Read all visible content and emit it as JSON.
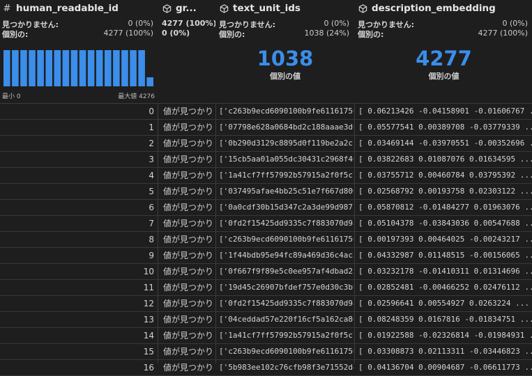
{
  "columns": {
    "human_readable_id": {
      "title": "human_readable_id",
      "icon": "hash-icon",
      "missing_label": "見つかりません:",
      "missing_value": "0 (0%)",
      "distinct_label": "個別の:",
      "distinct_value": "4277 (100%)",
      "min_label": "最小 0",
      "max_label": "最大値 4276",
      "histogram": [
        1,
        1,
        1,
        1,
        1,
        1,
        1,
        1,
        1,
        1,
        1,
        1,
        1,
        1,
        1,
        1,
        1,
        0.25
      ]
    },
    "graph": {
      "title": "gr...",
      "icon": "cube-icon",
      "line1_left": "4277 (100%)",
      "line1_right": "0 (0%)"
    },
    "text_unit_ids": {
      "title": "text_unit_ids",
      "icon": "cube-icon",
      "missing_label": "見つかりません:",
      "missing_value": "0 (0%)",
      "distinct_label": "個別の:",
      "distinct_value": "1038 (24%)",
      "big_number": "1038",
      "big_caption": "個別の値"
    },
    "description_embedding": {
      "title": "description_embedding",
      "icon": "cube-icon",
      "missing_label": "見つかりません:",
      "missing_value": "0 (0%)",
      "distinct_label": "個別の:",
      "distinct_value": "4277 (100%)",
      "big_number": "4277",
      "big_caption": "個別の値"
    }
  },
  "colors": {
    "accent": "#3b8eea",
    "background": "#1e1e1e"
  },
  "rows": [
    {
      "idx": "0",
      "graph": "値が見つかり",
      "text_unit": "['c263b9ecd6090100b9fe61161756d",
      "embedding": "[ 0.06213426 -0.04158901 -0.01606767 ... 0.00"
    },
    {
      "idx": "1",
      "graph": "値が見つかり",
      "text_unit": "['07798e628a0684bd2c188aaae3d6a",
      "embedding": "[ 0.05577541 0.00389708 -0.03779339 ... -0.001"
    },
    {
      "idx": "2",
      "graph": "値が見つかり",
      "text_unit": "['0b290d3129c8895d0f119be2a2cc0",
      "embedding": "[ 0.03469144 -0.03970551 -0.00352696 ... -0.02"
    },
    {
      "idx": "3",
      "graph": "値が見つかり",
      "text_unit": "['15cb5aa01a055dc30431c2968f4086",
      "embedding": "[ 0.03822683 0.01087076 0.01634595 ... -0.034"
    },
    {
      "idx": "4",
      "graph": "値が見つかり",
      "text_unit": "['1a41cf7ff57992b57915a2f0f5c727d",
      "embedding": "[ 0.03755712 0.00460784 0.03795392 ... -0.0115"
    },
    {
      "idx": "5",
      "graph": "値が見つかり",
      "text_unit": "['037495afae4bb25c51e7f667d8005f",
      "embedding": "[ 0.02568792 0.00193758 0.02303122 ... 0.0026"
    },
    {
      "idx": "6",
      "graph": "値が見つかり",
      "text_unit": "['0a0cdf30b15d347c2a3de99d987f72",
      "embedding": "[ 0.05870812 -0.01484277 0.01963076 ... 0.0005"
    },
    {
      "idx": "7",
      "graph": "値が見つかり",
      "text_unit": "['0fd2f15425dd9335c7f883070d9a8e",
      "embedding": "[ 0.05104378 -0.03843036 0.00547688 ... -0.012"
    },
    {
      "idx": "8",
      "graph": "値が見つかり",
      "text_unit": "['c263b9ecd6090100b9fe61161756d",
      "embedding": "[ 0.00197393 0.00464025 -0.00243217 ... 0.0065"
    },
    {
      "idx": "9",
      "graph": "値が見つかり",
      "text_unit": "['1f44bdb95e94fc89a469d36c4ac333",
      "embedding": "[ 0.04332987 0.01148515 -0.00156065 ... -0.006"
    },
    {
      "idx": "10",
      "graph": "値が見つかり",
      "text_unit": "['0f667f9f89e5c0ee957af4dbad23003",
      "embedding": "[ 0.03232178 -0.01410311 0.01314696 ... -0.017"
    },
    {
      "idx": "11",
      "graph": "値が見つかり",
      "text_unit": "['19d45c26907bfdef757e0d30c3b9b3",
      "embedding": "[ 0.02852481 -0.00466252 0.02476112 ... -0.031"
    },
    {
      "idx": "12",
      "graph": "値が見つかり",
      "text_unit": "['0fd2f15425dd9335c7f883070d9a8e",
      "embedding": "[ 0.02596641 0.00554927 0.0263224 ... -0.01145"
    },
    {
      "idx": "13",
      "graph": "値が見つかり",
      "text_unit": "['04ceddad57e220f16cf5a162ca80bb",
      "embedding": "[ 0.08248359 0.0167816 -0.01834751 ... -0.0024"
    },
    {
      "idx": "14",
      "graph": "値が見つかり",
      "text_unit": "['1a41cf7ff57992b57915a2f0f5c727d",
      "embedding": "[ 0.01922588 -0.02326814 -0.01984931 ... -0.00"
    },
    {
      "idx": "15",
      "graph": "値が見つかり",
      "text_unit": "['c263b9ecd6090100b9fe61161756d",
      "embedding": "[ 0.03308873 0.02113311 -0.03446823 ... -0.020"
    },
    {
      "idx": "16",
      "graph": "値が見つかり",
      "text_unit": "['5b983ee102c76cfb98f3e71552d4b2",
      "embedding": "[ 0.04136704 0.00904687 -0.06611773 ... -0.05"
    }
  ]
}
